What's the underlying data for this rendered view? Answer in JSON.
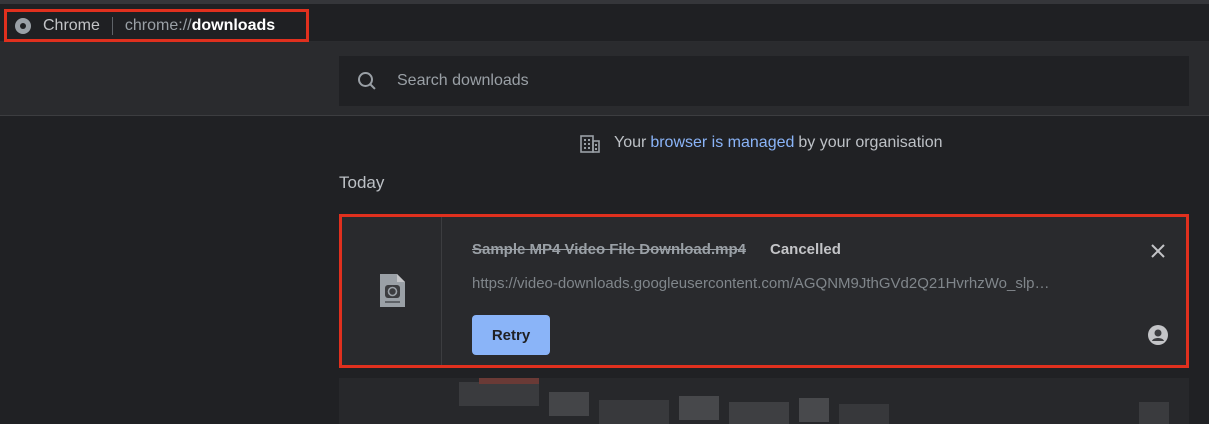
{
  "address_bar": {
    "site_chip": "Chrome",
    "url_scheme": "chrome://",
    "url_host": "downloads"
  },
  "search": {
    "placeholder": "Search downloads"
  },
  "managed_banner": {
    "prefix": "Your",
    "link_text": "browser is managed",
    "suffix": "by your organisation"
  },
  "section_heading": "Today",
  "download": {
    "file_name": "Sample MP4 Video File Download.mp4",
    "status": "Cancelled",
    "url": "https://video-downloads.googleusercontent.com/AGQNM9JthGVd2Q21HvrhzWo_slp…",
    "retry_label": "Retry",
    "file_icon": "video-file-icon",
    "close_icon": "close-icon",
    "profile_icon": "profile-icon"
  },
  "colors": {
    "accent": "#8ab4f8",
    "highlight_border": "#e0301e",
    "background": "#202124"
  }
}
